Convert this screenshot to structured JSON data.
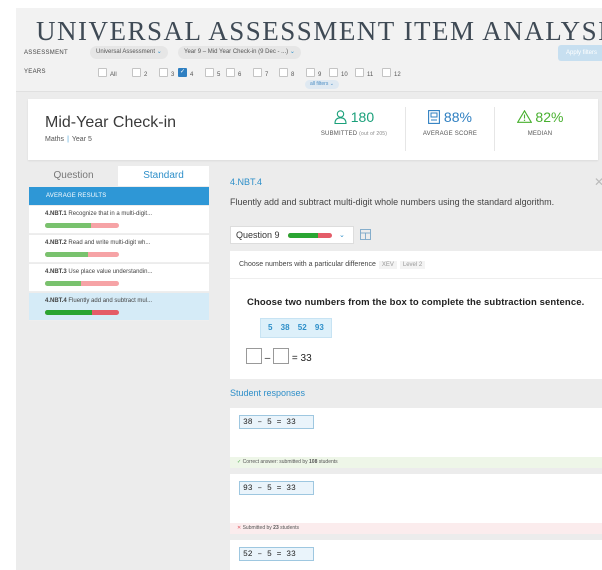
{
  "header": {
    "title": "UNIVERSAL ASSESSMENT ITEM ANALYSIS",
    "assessment_label": "ASSESSMENT",
    "assessment_value": "Universal Assessment",
    "test_value": "Year 9 – Mid Year Check-in (9 Dec - ...)",
    "apply_label": "Apply filters",
    "years_label": "YEARS",
    "years": [
      {
        "label": "All",
        "checked": false
      },
      {
        "label": "2",
        "checked": false
      },
      {
        "label": "3",
        "checked": false
      },
      {
        "label": "4",
        "checked": true
      },
      {
        "label": "5",
        "checked": false
      },
      {
        "label": "6",
        "checked": false
      },
      {
        "label": "7",
        "checked": false
      },
      {
        "label": "8",
        "checked": false
      },
      {
        "label": "9",
        "checked": false
      },
      {
        "label": "10",
        "checked": false
      },
      {
        "label": "11",
        "checked": false
      },
      {
        "label": "12",
        "checked": false
      }
    ],
    "all_filters": "all filters"
  },
  "summary": {
    "title": "Mid-Year Check-in",
    "subject": "Maths",
    "year": "Year 5",
    "submitted_value": "180",
    "submitted_label": "SUBMITTED",
    "submitted_sub": "(out of 205)",
    "avg_value": "88%",
    "avg_label": "AVERAGE SCORE",
    "median_value": "82%",
    "median_label": "MEDIAN",
    "colors": {
      "submitted": "#1aa07a",
      "avg": "#2e7fc1",
      "median": "#48b02f"
    }
  },
  "left": {
    "tab_question": "Question",
    "tab_standard": "Standard",
    "avg_header": "AVERAGE RESULTS",
    "standards": [
      {
        "code": "4.NBT.1",
        "text": "Recognize that in a multi-digit...",
        "correct": 0.62,
        "selected": false
      },
      {
        "code": "4.NBT.2",
        "text": "Read and write multi-digit wh...",
        "correct": 0.58,
        "selected": false
      },
      {
        "code": "4.NBT.3",
        "text": "Use place value understandin...",
        "correct": 0.48,
        "selected": false
      },
      {
        "code": "4.NBT.4",
        "text": "Fluently add and subtract mul...",
        "correct": 0.64,
        "selected": true
      }
    ]
  },
  "detail": {
    "code": "4.NBT.4",
    "description": "Fluently add and subtract multi-digit whole numbers using the standard algorithm.",
    "question_label": "Question 9",
    "meta_text": "Choose numbers with a particular difference",
    "meta_tag1": "XEV",
    "meta_tag2": "Level 2",
    "prompt": "Choose two numbers from the box to complete the subtraction sentence.",
    "numbers": "5 38 52 93",
    "equation_op": "–",
    "equation_rhs": "= 33",
    "responses_title": "Student responses",
    "responses": [
      {
        "answer": "38 – 5 = 33",
        "status": "ok",
        "foot_prefix": "Correct answer: submitted by",
        "count": "108",
        "foot_suffix": "students"
      },
      {
        "answer": "93 – 5 = 33",
        "status": "bad",
        "foot_prefix": "Submitted by",
        "count": "23",
        "foot_suffix": "students"
      },
      {
        "answer": "52 – 5 = 33",
        "status": "none",
        "foot_prefix": "",
        "count": "",
        "foot_suffix": ""
      }
    ]
  }
}
